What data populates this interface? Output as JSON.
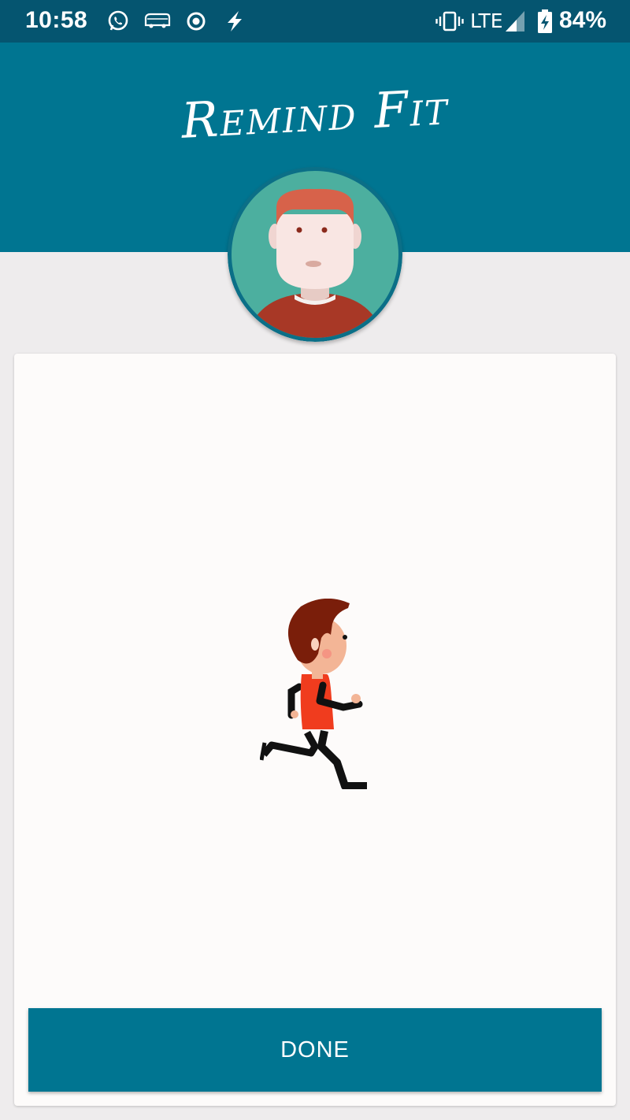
{
  "status_bar": {
    "time": "10:58",
    "network": "LTE",
    "battery": "84%",
    "icons": [
      "whatsapp-icon",
      "bus-icon",
      "record-icon",
      "flash-icon",
      "vibrate-icon",
      "signal-icon",
      "battery-charging-icon"
    ]
  },
  "header": {
    "title": "Remind Fit",
    "background_color": "#007591"
  },
  "avatar": {
    "icon": "user-avatar-icon"
  },
  "content": {
    "animation": "running-man-illustration"
  },
  "actions": {
    "done_label": "DONE"
  },
  "colors": {
    "accent": "#007591",
    "status_bar": "#055570",
    "background": "#eeeced"
  }
}
